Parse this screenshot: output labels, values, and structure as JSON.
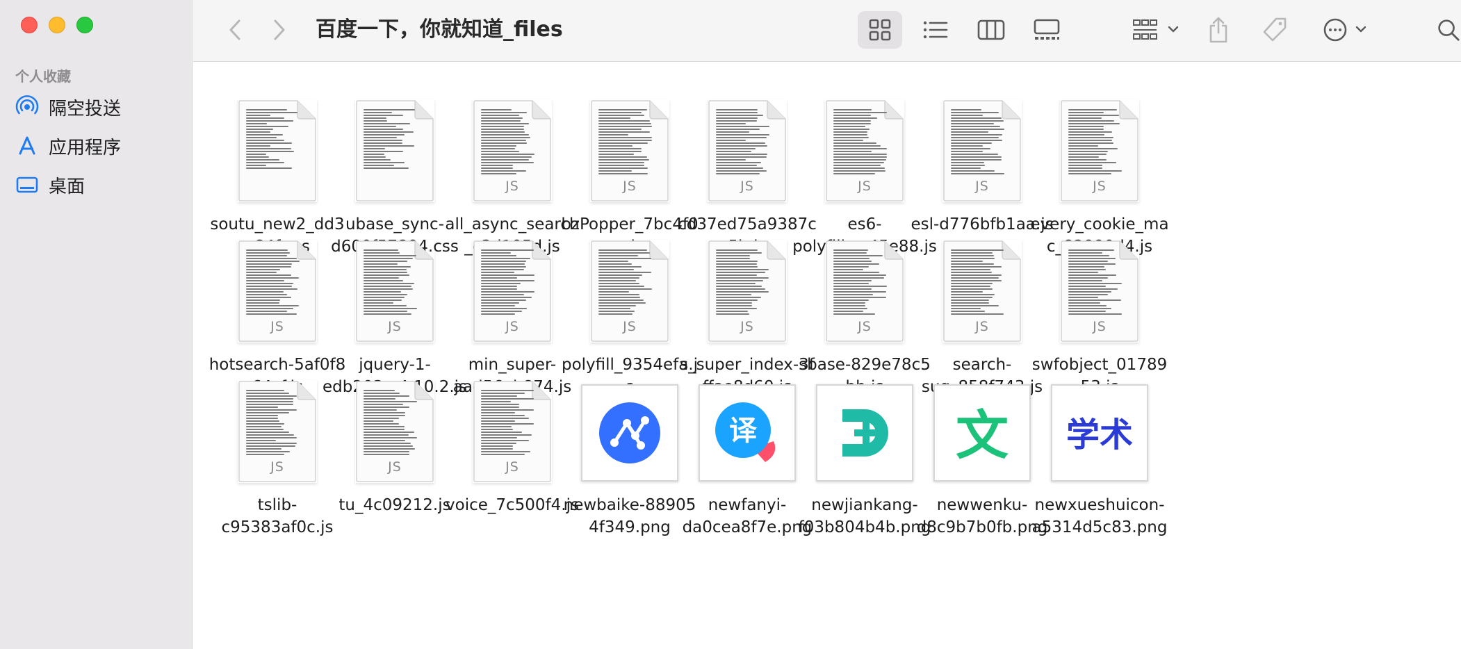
{
  "window": {
    "title": "百度一下，你就知道_files",
    "controls": [
      "close",
      "minimize",
      "zoom"
    ]
  },
  "sidebar": {
    "section_title": "个人收藏",
    "items": [
      {
        "label": "隔空投送",
        "icon": "airdrop-icon"
      },
      {
        "label": "应用程序",
        "icon": "applications-icon"
      },
      {
        "label": "桌面",
        "icon": "desktop-icon"
      }
    ]
  },
  "toolbar": {
    "back_icon": "chevron-left-icon",
    "forward_icon": "chevron-right-icon",
    "view_modes": [
      "icon-view",
      "list-view",
      "column-view",
      "gallery-view"
    ],
    "active_view": "icon-view",
    "actions": [
      "group-menu",
      "share",
      "tag",
      "more-menu",
      "search"
    ]
  },
  "files": [
    {
      "name": "soutu_new2_dd3\na84f.css",
      "kind": "text"
    },
    {
      "name": "ubase_sync-\nd600f57804.css",
      "kind": "text"
    },
    {
      "name": "all_async_search\n_c3d105d.js",
      "kind": "js"
    },
    {
      "name": "bzPopper_7bc4f0\ne.js",
      "kind": "js"
    },
    {
      "name": "cd37ed75a9387c\n5b.js",
      "kind": "js"
    },
    {
      "name": "es6-\npolyfill_...45e88.js",
      "kind": "js"
    },
    {
      "name": "esl-d776bfb1aa.js",
      "kind": "js"
    },
    {
      "name": "every_cookie_ma\nc_82990d4.js",
      "kind": "js"
    },
    {
      "name": "hotsearch-5af0f8\n64cf.js",
      "kind": "js"
    },
    {
      "name": "jquery-1-\nedb203...4.10.2.js",
      "kind": "js"
    },
    {
      "name": "min_super-\naad56eb874.js",
      "kind": "js"
    },
    {
      "name": "polyfill_9354efa.j\ns",
      "kind": "js"
    },
    {
      "name": "s_super_index-3f\nffae8d60.js",
      "kind": "js"
    },
    {
      "name": "sbase-829e78c5\nbb.js",
      "kind": "js"
    },
    {
      "name": "search-\nsug_858f743.js",
      "kind": "js"
    },
    {
      "name": "swfobject_01789\n53.js",
      "kind": "js"
    },
    {
      "name": "tslib-\nc95383af0c.js",
      "kind": "js"
    },
    {
      "name": "tu_4c09212.js",
      "kind": "js"
    },
    {
      "name": "voice_7c500f4.js",
      "kind": "js"
    },
    {
      "name": "newbaike-88905\n4f349.png",
      "kind": "png",
      "icon": "baike-logo-icon",
      "color": "#3370ff"
    },
    {
      "name": "newfanyi-\nda0cea8f7e.png",
      "kind": "png",
      "icon": "fanyi-logo-icon",
      "color": "#1aa3ff",
      "glyph": "译"
    },
    {
      "name": "newjiankang-\nf03b804b4b.png",
      "kind": "png",
      "icon": "jiankang-logo-icon",
      "color": "#1fbba6"
    },
    {
      "name": "newwenku-\nd8c9b7b0fb.png",
      "kind": "png",
      "icon": "wenku-logo-icon",
      "color": "#1cc27a",
      "glyph": "文"
    },
    {
      "name": "newxueshuicon-\na5314d5c83.png",
      "kind": "png",
      "icon": "xueshu-logo-icon",
      "color": "#2b3bd6",
      "glyph": "学术"
    }
  ],
  "js_badge": "JS"
}
